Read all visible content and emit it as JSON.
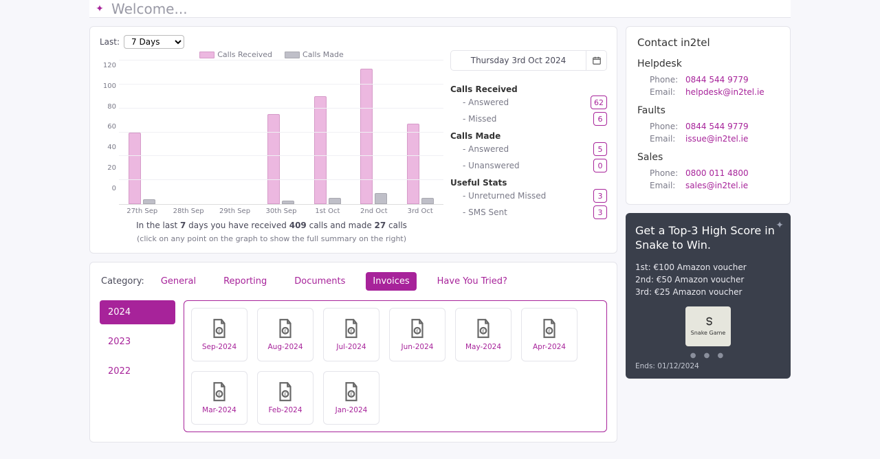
{
  "header": {
    "welcome": "Welcome..."
  },
  "dashboard": {
    "last_label": "Last:",
    "period_selected": "7 Days",
    "legend_received": "Calls Received",
    "legend_made": "Calls Made",
    "caption_pre": "In the last ",
    "caption_days": "7",
    "caption_mid": " days you have received ",
    "caption_received": "409",
    "caption_mid2": " calls and made ",
    "caption_made": "27",
    "caption_post": " calls",
    "subcaption": "(click on any point on the graph to show the full summary on the right)"
  },
  "chart_data": {
    "type": "bar",
    "categories": [
      "27th Sep",
      "28th Sep",
      "29th Sep",
      "30th Sep",
      "1st Oct",
      "2nd Oct",
      "3rd Oct"
    ],
    "series": [
      {
        "name": "Calls Received",
        "values": [
          60,
          0,
          0,
          75,
          90,
          113,
          67
        ],
        "color": "#ecb8e0"
      },
      {
        "name": "Calls Made",
        "values": [
          4,
          0,
          0,
          3,
          5,
          9,
          5
        ],
        "color": "#bfbfc8"
      }
    ],
    "ylim": [
      0,
      120
    ],
    "yticks": [
      0,
      20,
      40,
      60,
      80,
      100,
      120
    ]
  },
  "stats": {
    "date_display": "Thursday 3rd Oct 2024",
    "groups": [
      {
        "title": "Calls Received",
        "rows": [
          {
            "label": "- Answered",
            "value": "62"
          },
          {
            "label": "- Missed",
            "value": "6"
          }
        ]
      },
      {
        "title": "Calls Made",
        "rows": [
          {
            "label": "- Answered",
            "value": "5"
          },
          {
            "label": "- Unanswered",
            "value": "0"
          }
        ]
      },
      {
        "title": "Useful Stats",
        "rows": [
          {
            "label": "- Unreturned Missed",
            "value": "3"
          },
          {
            "label": "- SMS Sent",
            "value": "3"
          }
        ]
      }
    ]
  },
  "categories": {
    "label": "Category:",
    "tabs": [
      "General",
      "Reporting",
      "Documents",
      "Invoices",
      "Have You Tried?"
    ],
    "active_tab": "Invoices",
    "years": [
      "2024",
      "2023",
      "2022"
    ],
    "active_year": "2024",
    "invoices": [
      "Sep-2024",
      "Aug-2024",
      "Jul-2024",
      "Jun-2024",
      "May-2024",
      "Apr-2024",
      "Mar-2024",
      "Feb-2024",
      "Jan-2024"
    ]
  },
  "contact": {
    "title": "Contact in2tel",
    "sections": [
      {
        "title": "Helpdesk",
        "phone": "0844 544 9779",
        "email": "helpdesk@in2tel.ie"
      },
      {
        "title": "Faults",
        "phone": "0844 544 9779",
        "email": "issue@in2tel.ie"
      },
      {
        "title": "Sales",
        "phone": "0800 011 4800",
        "email": "sales@in2tel.ie"
      }
    ],
    "phone_label": "Phone:",
    "email_label": "Email:"
  },
  "promo": {
    "title": "Get a Top-3 High Score in Snake to Win.",
    "prizes": [
      "1st: €100 Amazon voucher",
      "2nd: €50 Amazon voucher",
      "3rd: €25 Amazon voucher"
    ],
    "game_label": "Snake Game",
    "ends": "Ends: 01/12/2024"
  }
}
